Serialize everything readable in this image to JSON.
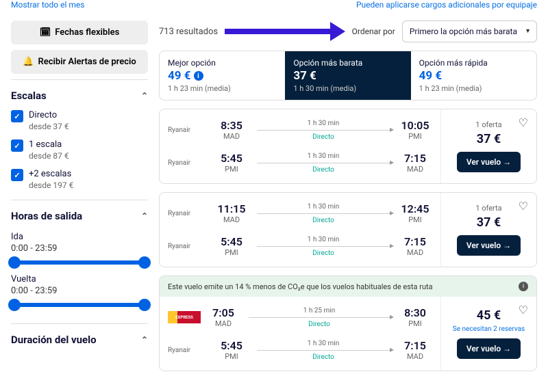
{
  "topLinks": {
    "left": "Mostrar todo el mes",
    "right": "Pueden aplicarse cargos adicionales por equipaje"
  },
  "sidebar": {
    "flexDates": "Fechas flexibles",
    "priceAlert": "Recibir Alertas de precio",
    "stops": {
      "title": "Escalas",
      "items": [
        {
          "label": "Directo",
          "sub": "desde 37 €"
        },
        {
          "label": "1 escala",
          "sub": "desde 87 €"
        },
        {
          "label": "+2 escalas",
          "sub": "desde 197 €"
        }
      ]
    },
    "departTimes": {
      "title": "Horas de salida",
      "outbound": {
        "label": "Ida",
        "range": "0:00 - 23:59"
      },
      "return": {
        "label": "Vuelta",
        "range": "0:00 - 23:59"
      }
    },
    "duration": {
      "title": "Duración del vuelo"
    }
  },
  "main": {
    "resultsCount": "713 resultados",
    "sortBy": {
      "label": "Ordenar por",
      "selected": "Primero la opción más barata"
    },
    "tabs": [
      {
        "title": "Mejor opción",
        "price": "49 €",
        "meta": "1 h 23 min (media)",
        "active": false,
        "info": true
      },
      {
        "title": "Opción más barata",
        "price": "37 €",
        "meta": "1 h 30 min (media)",
        "active": true
      },
      {
        "title": "Opción más rápida",
        "price": "49 €",
        "meta": "1 h 23 min (media)",
        "active": false
      }
    ],
    "cards": [
      {
        "legs": [
          {
            "airline": "Ryanair",
            "depTime": "8:35",
            "depCode": "MAD",
            "duration": "1 h 30 min",
            "type": "Directo",
            "arrTime": "10:05",
            "arrCode": "PMI"
          },
          {
            "airline": "Ryanair",
            "depTime": "5:45",
            "depCode": "PMI",
            "duration": "1 h 30 min",
            "type": "Directo",
            "arrTime": "7:15",
            "arrCode": "MAD"
          }
        ],
        "offers": "1 oferta",
        "price": "37 €",
        "cta": "Ver vuelo"
      },
      {
        "legs": [
          {
            "airline": "Ryanair",
            "depTime": "11:15",
            "depCode": "MAD",
            "duration": "1 h 30 min",
            "type": "Directo",
            "arrTime": "12:45",
            "arrCode": "PMI"
          },
          {
            "airline": "Ryanair",
            "depTime": "5:45",
            "depCode": "PMI",
            "duration": "1 h 30 min",
            "type": "Directo",
            "arrTime": "7:15",
            "arrCode": "MAD"
          }
        ],
        "offers": "1 oferta",
        "price": "37 €",
        "cta": "Ver vuelo"
      },
      {
        "eco": "Este vuelo emite un 14 % menos de CO₂e que los vuelos habituales de esta ruta",
        "legs": [
          {
            "airlineLogo": "IBERIA EXPRESS",
            "depTime": "7:05",
            "depCode": "MAD",
            "duration": "1 h 25 min",
            "type": "Directo",
            "arrTime": "8:30",
            "arrCode": "PMI"
          },
          {
            "airline": "Ryanair",
            "depTime": "5:45",
            "depCode": "PMI",
            "duration": "1 h 30 min",
            "type": "Directo",
            "arrTime": "7:15",
            "arrCode": "MAD"
          }
        ],
        "price": "45 €",
        "note": "Se necesitan 2 reservas",
        "cta": "Ver vuelo"
      }
    ]
  }
}
